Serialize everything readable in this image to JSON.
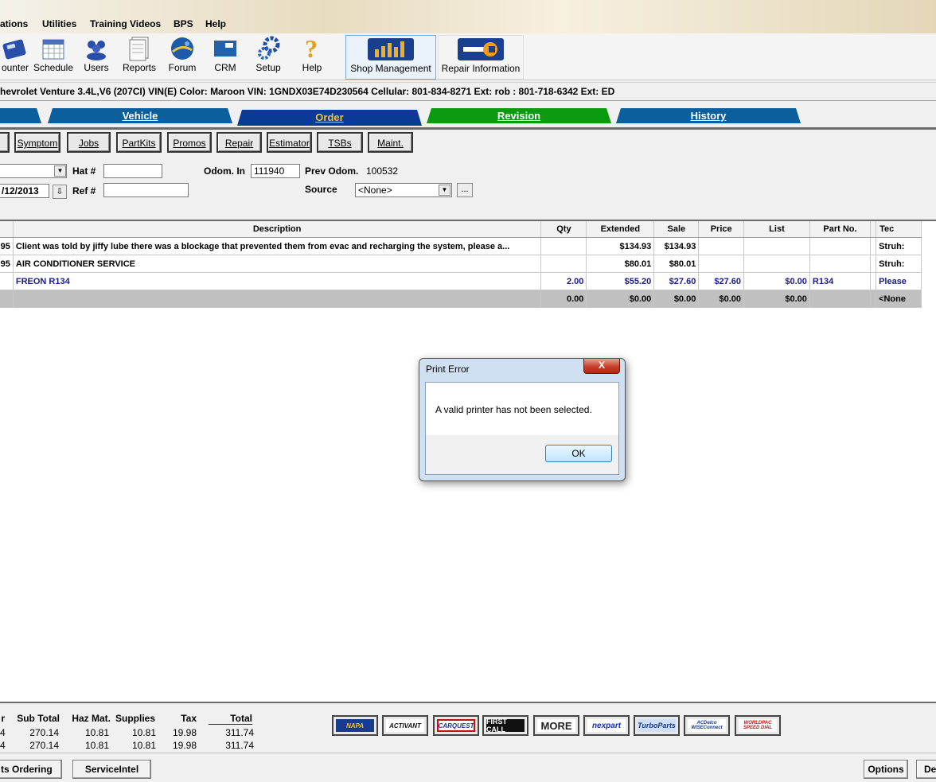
{
  "menu": [
    "ations",
    "Utilities",
    "Training Videos",
    "BPS",
    "Help"
  ],
  "toolbar": {
    "counter": "ounter",
    "schedule": "Schedule",
    "users": "Users",
    "reports": "Reports",
    "forum": "Forum",
    "crm": "CRM",
    "setup": "Setup",
    "help": "Help",
    "shop_management": "Shop Management",
    "repair_information": "Repair Information"
  },
  "vehicle_line": "hevrolet Venture   3.4L,V6 (207CI) VIN(E)   Color: Maroon   VIN: 1GNDX03E74D230564   Cellular: 801-834-8271 Ext: rob   : 801-718-6342 Ext: ED",
  "tabs": {
    "vehicle": "Vehicle",
    "order": "Order",
    "revision": "Revision",
    "history": "History"
  },
  "buttons": {
    "symptom": "Symptom",
    "jobs": "Jobs",
    "partkits": "PartKits",
    "promos": "Promos",
    "repair": "Repair",
    "estimator": "Estimator",
    "tsbs": "TSBs",
    "maint": "Maint."
  },
  "form": {
    "hat_label": "Hat #",
    "hat_value": "",
    "ref_label": "Ref #",
    "ref_value": "",
    "date_value": "/12/2013",
    "odom_in_label": "Odom. In",
    "odom_in_value": "111940",
    "prev_odom_label": "Prev Odom.",
    "prev_odom_value": "100532",
    "source_label": "Source",
    "source_value": "<None>",
    "ellipsis": "..."
  },
  "grid": {
    "columns": [
      "",
      "Description",
      "Qty",
      "Extended",
      "Sale",
      "Price",
      "List",
      "Part No.",
      "Tec"
    ],
    "rows": [
      {
        "lead": ".95",
        "description": "Client was told by jiffy lube there was a blockage that prevented them from evac and recharging the system, please a...",
        "qty": "",
        "extended": "$134.93",
        "sale": "$134.93",
        "price": "",
        "list": "",
        "part_no": "",
        "tech": "Struh:"
      },
      {
        "lead": ".95",
        "description": "AIR CONDITIONER SERVICE",
        "qty": "",
        "extended": "$80.01",
        "sale": "$80.01",
        "price": "",
        "list": "",
        "part_no": "",
        "tech": "Struh:"
      },
      {
        "lead": "",
        "description": "FREON R134",
        "qty": "2.00",
        "extended": "$55.20",
        "sale": "$27.60",
        "price": "$27.60",
        "list": "$0.00",
        "part_no": "R134",
        "tech": "Please"
      },
      {
        "lead": "",
        "description": "",
        "qty": "0.00",
        "extended": "$0.00",
        "sale": "$0.00",
        "price": "$0.00",
        "list": "$0.00",
        "part_no": "",
        "tech": "<None"
      }
    ]
  },
  "totals": {
    "headers": [
      "r",
      "Sub Total",
      "Haz Mat.",
      "Supplies",
      "Tax",
      "Total"
    ],
    "row1": [
      "4",
      "270.14",
      "10.81",
      "10.81",
      "19.98",
      "311.74"
    ],
    "row2": [
      "4",
      "270.14",
      "10.81",
      "10.81",
      "19.98",
      "311.74"
    ]
  },
  "vendor_logos": [
    "NAPA",
    "ACTIVANT",
    "CARQUEST",
    "FIRST CALL",
    "MORE",
    "nexpart",
    "TurboParts",
    "ACDelco WISEConnect",
    "WORLDPAC SPEED DIAL"
  ],
  "bottom_buttons": {
    "parts_ordering": "ts Ordering",
    "serviceintel": "ServiceIntel",
    "options": "Options",
    "de": "De"
  },
  "dialog": {
    "title": "Print Error",
    "message": "A valid printer has not been selected.",
    "ok": "OK",
    "close": "X"
  },
  "colors": {
    "tab_vehicle": "#0a5f9c",
    "tab_order": "#0b3a96",
    "tab_order_text": "#f0c040",
    "tab_revision": "#0a9a10",
    "tab_history": "#0a5f9c"
  }
}
